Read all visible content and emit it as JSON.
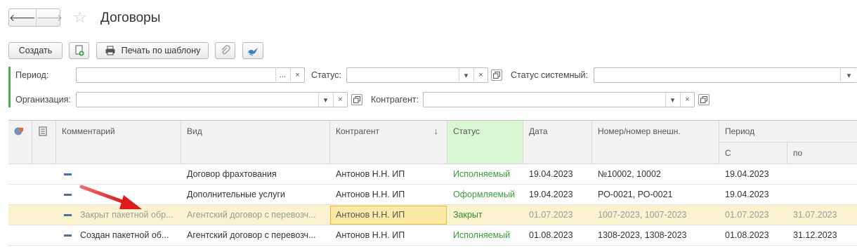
{
  "header": {
    "title": "Договоры",
    "back_glyph": "🡐",
    "forward_glyph": "🡒",
    "star_glyph": "☆"
  },
  "toolbar": {
    "create_label": "Создать",
    "print_label": "Печать по шаблону"
  },
  "filters": {
    "period_label": "Период:",
    "period_btn": "...",
    "clear_glyph": "×",
    "dropdown_glyph": "▾",
    "status_label": "Статус:",
    "system_status_label": "Статус системный:",
    "organization_label": "Организация:",
    "counterparty_label": "Контрагент:"
  },
  "table": {
    "columns": {
      "comment": "Комментарий",
      "kind": "Вид",
      "counterparty": "Контрагент",
      "sort_glyph": "↓",
      "status": "Статус",
      "date": "Дата",
      "number": "Номер/номер внешн.",
      "period": "Период",
      "period_from": "С",
      "period_to": "по"
    },
    "rows": [
      {
        "comment": "",
        "kind": "Договор фрахтования",
        "counterparty": "Антонов Н.Н. ИП",
        "status": "Исполняемый",
        "date": "19.04.2023",
        "number": "№10002, 10002",
        "from": "19.04.2023",
        "to": ""
      },
      {
        "comment": "",
        "kind": "Дополнительные услуги",
        "counterparty": "Антонов Н.Н. ИП",
        "status": "Оформляемый",
        "date": "19.04.2023",
        "number": "РО-0021, РО-0021",
        "from": "19.04.2023",
        "to": ""
      },
      {
        "comment": "Закрыт пакетной обр...",
        "kind": "Агентский договор с перевозч...",
        "counterparty": "Антонов Н.Н. ИП",
        "status": "Закрыт",
        "date": "01.07.2023",
        "number": "1007-2023, 1007-2023",
        "from": "01.07.2023",
        "to": "31.07.2023"
      },
      {
        "comment": "Создан пакетной об...",
        "kind": "Агентский договор с перевозч...",
        "counterparty": "Антонов Н.Н. ИП",
        "status": "Исполняемый",
        "date": "01.08.2023",
        "number": "1308-2023, 1308-2023",
        "from": "01.08.2023",
        "to": "31.12.2023"
      }
    ]
  },
  "colors": {
    "status_green": "#3c9b3c",
    "selected_row": "#fbf3cf",
    "arrow": "#e02020"
  }
}
